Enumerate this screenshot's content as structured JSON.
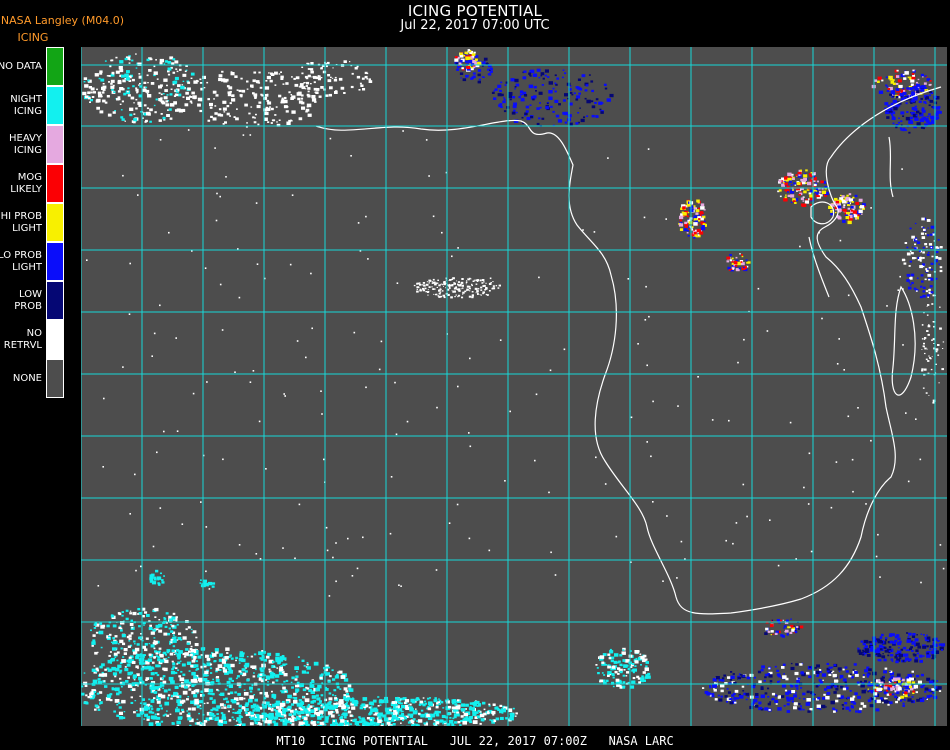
{
  "header": {
    "title": "ICING POTENTIAL",
    "datetime": "Jul 22, 2017 07:00 UTC",
    "organization": "NASA Langley (M04.0)"
  },
  "legend": {
    "title": "ICING",
    "items": [
      {
        "label": "NO DATA",
        "color": "#12a515"
      },
      {
        "label": "NIGHT\nICING",
        "color": "#12f0ef"
      },
      {
        "label": "HEAVY\nICING",
        "color": "#e5a9e0"
      },
      {
        "label": "MOG\nLIKELY",
        "color": "#fb0004"
      },
      {
        "label": "HI PROB\nLIGHT",
        "color": "#f8f000"
      },
      {
        "label": "LO PROB\nLIGHT",
        "color": "#0a0dfa"
      },
      {
        "label": "LOW\nPROB",
        "color": "#050774"
      },
      {
        "label": "NO\nRETRVL",
        "color": "#ffffff"
      },
      {
        "label": "NONE",
        "color": "#4d4d4d"
      }
    ]
  },
  "map": {
    "background_color": "#4d4d4d",
    "grid_color": "#18d8d8",
    "coastline_color": "#ffffff",
    "grid_label_color": "#d01010"
  },
  "footer": {
    "text": "MT10  ICING POTENTIAL   JUL 22, 2017 07:00Z   NASA LARC"
  }
}
